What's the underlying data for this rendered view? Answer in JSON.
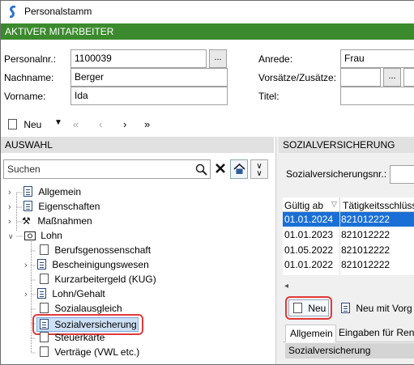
{
  "window": {
    "title": "Personalstamm"
  },
  "active_bar": {
    "label": "AKTIVER MITARBEITER"
  },
  "form": {
    "personalnr_label": "Personalnr.:",
    "personalnr_value": "1100039",
    "nachname_label": "Nachname:",
    "nachname_value": "Berger",
    "vorname_label": "Vorname:",
    "vorname_value": "Ida",
    "anrede_label": "Anrede:",
    "anrede_value": "Frau",
    "vorsaetze_label": "Vorsätze/Zusätze:",
    "titel_label": "Titel:",
    "ellipsis": "..."
  },
  "toolbar": {
    "new_label": "Neu"
  },
  "auswahl": {
    "header": "AUSWAHL",
    "search_placeholder": "Suchen",
    "tree": [
      {
        "label": "Allgemein"
      },
      {
        "label": "Eigenschaften"
      },
      {
        "label": "Maßnahmen"
      },
      {
        "label": "Lohn"
      },
      {
        "label": "Berufsgenossenschaft"
      },
      {
        "label": "Bescheinigungswesen"
      },
      {
        "label": "Kurzarbeitergeld (KUG)"
      },
      {
        "label": "Lohn/Gehalt"
      },
      {
        "label": "Sozialausgleich"
      },
      {
        "label": "Sozialversicherung"
      },
      {
        "label": "Steuerkarte"
      },
      {
        "label": "Verträge (VWL etc.)"
      }
    ]
  },
  "sv": {
    "header": "SOZIALVERSICHERUNG",
    "nr_label": "Sozialversicherungsnr.:",
    "col_gueltig": "Gültig ab",
    "col_taetig": "Tätigkeitsschlüss",
    "rows": [
      {
        "date": "01.01.2024",
        "code": "821012222"
      },
      {
        "date": "01.01.2023",
        "code": "821012222"
      },
      {
        "date": "01.05.2022",
        "code": "821012222"
      },
      {
        "date": "01.01.2022",
        "code": "821012222"
      }
    ],
    "new_label": "Neu",
    "new_with_label": "Neu mit Vorg",
    "tabs": [
      "Allgemein",
      "Eingaben für Ren"
    ],
    "section_label": "Sozialversicherung"
  },
  "colors": {
    "accent_green": "#3c8a2e",
    "selection_blue": "#1a6fd6",
    "highlight_red": "#e03a3a"
  }
}
